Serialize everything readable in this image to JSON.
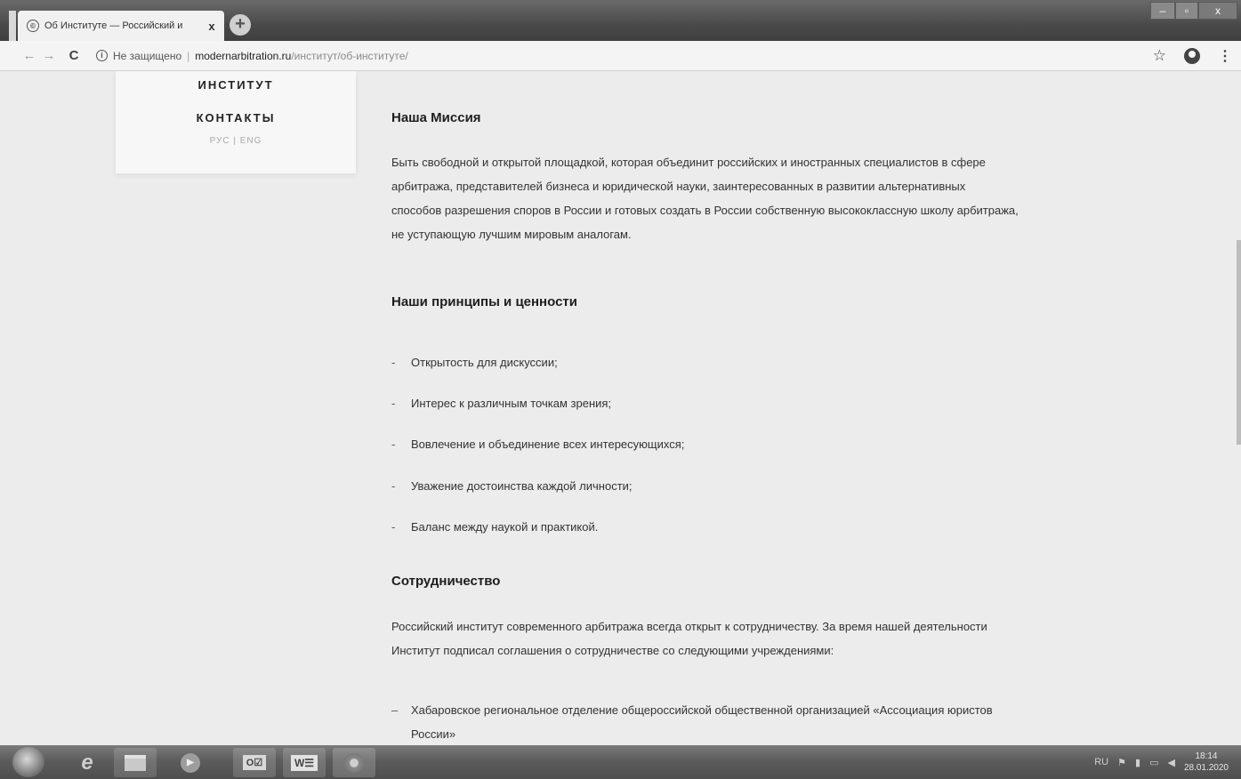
{
  "browser": {
    "tab_title": "Об Институте — Российский и",
    "tab_close": "x",
    "new_tab": "+",
    "window_controls": {
      "minimize": "‒",
      "maximize": "▫",
      "close": "x"
    }
  },
  "addressbar": {
    "back": "←",
    "forward": "→",
    "reload": "C",
    "info": "i",
    "secure_label": "Не защищено",
    "separator": "|",
    "url_host": "modernarbitration.ru",
    "url_path": "/институт/об-институте/",
    "star": "☆",
    "menu": "⋮"
  },
  "site_nav": {
    "institute": "ИНСТИТУТ",
    "contacts": "КОНТАКТЫ",
    "languages": "РУС | ENG"
  },
  "mission": {
    "heading": "Наша Миссия",
    "lines": [
      "Быть свободной и открытой площадкой, которая объединит российских и иностранных специалистов в сфере",
      "арбитража, представителей бизнеса и юридической науки, заинтересованных в развитии альтернативных",
      "способов разрешения споров в России и готовых создать в России собственную высококлассную школу арбитража,",
      "не уступающую лучшим мировым аналогам."
    ]
  },
  "principles": {
    "heading": "Наши принципы и ценности",
    "items": [
      "Открытость для дискуссии;",
      "Интерес к различным точкам зрения;",
      "Вовлечение и объединение всех интересующихся;",
      "Уважение достоинства каждой личности;",
      "Баланс между наукой и практикой."
    ]
  },
  "cooperation": {
    "heading": "Сотрудничество",
    "lines": [
      "Российский институт современного арбитража всегда открыт к сотрудничеству. За время нашей деятельности",
      "Институт подписал соглашения о сотрудничестве со следующими учреждениями:"
    ],
    "partner_lines": [
      "Хабаровское региональное отделение общероссийской общественной организацией «Ассоциация юристов",
      "России»"
    ]
  },
  "taskbar": {
    "outlook_label": "O☑",
    "word_label": "W☰",
    "media_label": "▶",
    "tray_lang": "RU",
    "time": "18:14",
    "date": "28.01.2020"
  }
}
